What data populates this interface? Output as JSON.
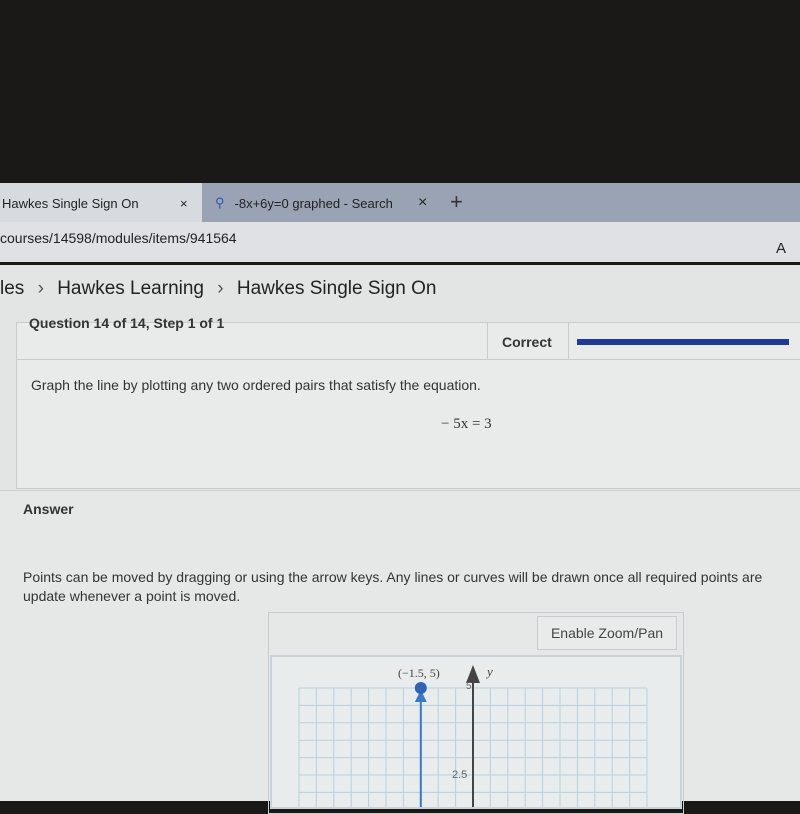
{
  "browser": {
    "tabs": [
      {
        "label": "Hawkes Single Sign On",
        "close": "×"
      },
      {
        "label": "-8x+6y=0 graphed - Search",
        "close": "×"
      }
    ],
    "new_tab": "+",
    "address": "courses/14598/modules/items/941564",
    "read_aloud": "A"
  },
  "breadcrumb": [
    "les",
    "Hawkes Learning",
    "Hawkes Single Sign On"
  ],
  "breadcrumb_sep": "›",
  "question": {
    "header": "Question 14 of 14, Step 1 of 1",
    "status": "Correct",
    "progress": 1.0,
    "prompt": "Graph the line by plotting any two ordered pairs that satisfy the equation.",
    "equation": "− 5x = 3"
  },
  "answer": {
    "label": "Answer",
    "instructions": "Points can be moved by dragging or using the arrow keys. Any lines or curves will be drawn once all required points are",
    "instructions2": "update whenever a point is moved.",
    "zoom_button": "Enable Zoom/Pan"
  },
  "graph": {
    "point_label": "(−1.5, 5)",
    "y_axis_label": "y",
    "y_ticks": [
      "5",
      "2.5"
    ],
    "point": [
      -1.5,
      5
    ],
    "line_x": -1.5,
    "line_color": "#3b78c9",
    "xlim": [
      -5,
      5
    ]
  }
}
